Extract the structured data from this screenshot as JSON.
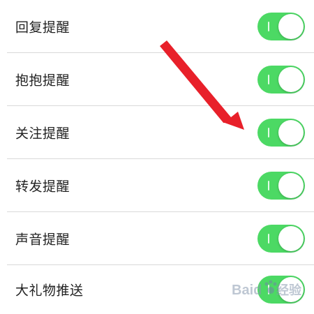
{
  "settings": {
    "items": [
      {
        "label": "回复提醒",
        "enabled": true
      },
      {
        "label": "抱抱提醒",
        "enabled": true
      },
      {
        "label": "关注提醒",
        "enabled": true
      },
      {
        "label": "转发提醒",
        "enabled": true
      },
      {
        "label": "声音提醒",
        "enabled": true
      },
      {
        "label": "大礼物推送",
        "enabled": true
      }
    ]
  },
  "colors": {
    "toggle_on": "#4cd964",
    "arrow": "#e8202a",
    "divider": "#d9d9d9",
    "text": "#222222"
  },
  "watermark": {
    "text_latin": "Baid",
    "text_cn": "经验",
    "icon": "paw-icon"
  }
}
